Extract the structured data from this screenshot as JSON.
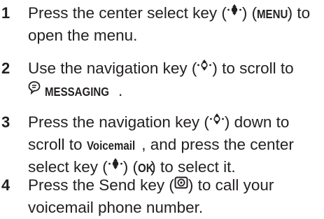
{
  "steps": [
    {
      "number": "1",
      "lines": [
        [
          "Press the center select key (",
          ") (",
          "MENU",
          ") to"
        ],
        [
          "open the menu."
        ]
      ]
    },
    {
      "number": "2",
      "lines": [
        [
          "Use the navigation key (",
          ") to scroll to"
        ],
        [
          "MESSAGING",
          "."
        ]
      ]
    },
    {
      "number": "3",
      "lines": [
        [
          "Press the navigation key (",
          ") down to"
        ],
        [
          "scroll to ",
          "Voicemail",
          ", and press the center"
        ],
        [
          "select key (",
          ") (",
          "OK",
          ") to select it."
        ]
      ]
    },
    {
      "number": "4",
      "lines": [
        [
          "Press the Send key (",
          ") to call your"
        ],
        [
          "voicemail phone number."
        ]
      ]
    }
  ],
  "icons": {
    "center_select": "center-select-key-icon",
    "navigation": "navigation-key-icon",
    "messaging": "messaging-menu-icon",
    "send": "send-key-icon"
  }
}
